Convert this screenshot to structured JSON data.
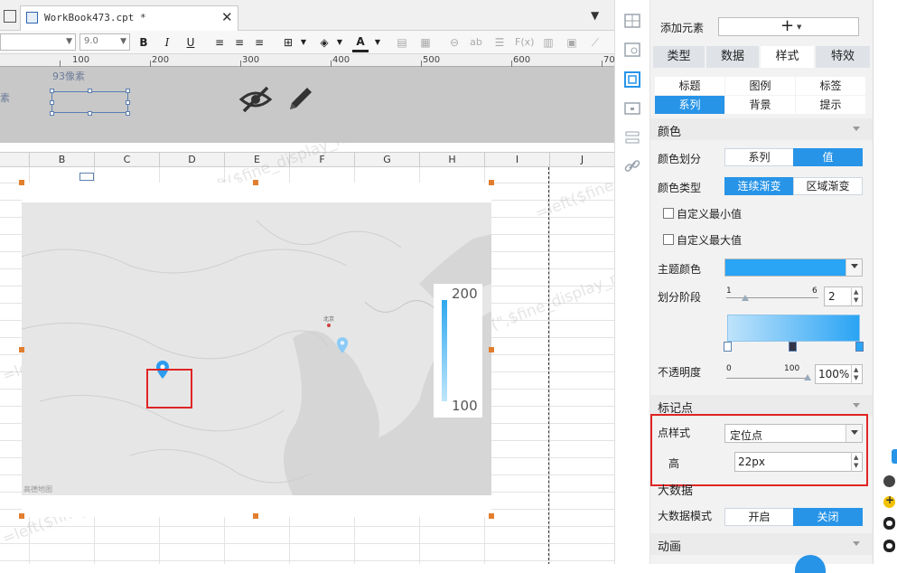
{
  "tabbar": {
    "file_name": "WorkBook473.cpt *",
    "close_glyph": "✕",
    "menu_glyph": "▼"
  },
  "format_toolbar": {
    "font_size_value": "9.0",
    "bold_label": "B",
    "italic_label": "I",
    "underline_label": "U",
    "font_color_label": "A",
    "icons": [
      "align-left-icon",
      "align-center-icon",
      "align-right-icon",
      "border-icon",
      "fill-color-icon",
      "font-color-icon",
      "merge-cells-icon",
      "insert-table-icon",
      "link-icon",
      "text-ab-icon",
      "text-format-icon",
      "formula-icon",
      "image-icon",
      "clear-icon"
    ]
  },
  "ruler": {
    "labels": [
      "100",
      "200",
      "300",
      "400",
      "500",
      "600",
      "70"
    ]
  },
  "design_band": {
    "size_label": "93像素",
    "left_text": "素"
  },
  "columns": [
    "B",
    "C",
    "D",
    "E",
    "F",
    "G",
    "H",
    "I",
    "J"
  ],
  "watermark": "=left($fine_display_name.find(\"(\",$fine_display_name)-1)",
  "chart": {
    "legend_max": "200",
    "legend_min": "100",
    "city_label": "北京",
    "attribution": "高德地图"
  },
  "rail": {
    "icons": [
      "cell-attr-icon",
      "cell-element-icon",
      "widget-attr-icon",
      "chart-attr-icon",
      "condition-icon",
      "hyperlink-icon"
    ]
  },
  "panel": {
    "add_element_label": "添加元素",
    "add_button_label": "+",
    "main_tabs": [
      {
        "label": "类型"
      },
      {
        "label": "数据"
      },
      {
        "label": "样式"
      },
      {
        "label": "特效"
      }
    ],
    "sub_tabs_row1": [
      "标题",
      "图例",
      "标签"
    ],
    "sub_tabs_row2": [
      "系列",
      "背景",
      "提示"
    ],
    "color_section": "颜色",
    "color_division_label": "颜色划分",
    "color_division_options": [
      "系列",
      "值"
    ],
    "color_type_label": "颜色类型",
    "color_type_options": [
      "连续渐变",
      "区域渐变"
    ],
    "custom_min_label": "自定义最小值",
    "custom_max_label": "自定义最大值",
    "theme_color_label": "主题颜色",
    "theme_color": "#2aa4f4",
    "division_stage_label": "划分阶段",
    "stage_min": "1",
    "stage_max": "6",
    "stage_value": "2",
    "opacity_label": "不透明度",
    "opacity_min": "0",
    "opacity_max": "100",
    "opacity_value": "100%",
    "marker_section": "标记点",
    "point_style_label": "点样式",
    "point_style_value": "定位点",
    "height_label": "高",
    "height_value": "22px",
    "big_data_section": "大数据",
    "big_data_mode_label": "大数据模式",
    "big_data_options": [
      "开启",
      "关闭"
    ],
    "animation_section": "动画"
  }
}
